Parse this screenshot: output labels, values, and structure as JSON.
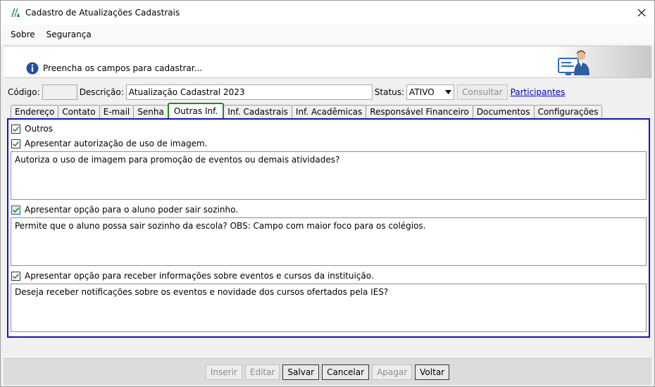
{
  "window": {
    "title": "Cadastro de Atualizações Cadastrais"
  },
  "menu": {
    "items": [
      "Sobre",
      "Segurança"
    ]
  },
  "hint": {
    "text": "Preencha os campos para cadastrar..."
  },
  "form": {
    "codigo_label": "Código:",
    "codigo_value": "",
    "descricao_label": "Descrição:",
    "descricao_value": "Atualização Cadastral 2023",
    "status_label": "Status:",
    "status_value": "ATIVO",
    "consultar_label": "Consultar",
    "participantes_label": "Participantes"
  },
  "tabs": [
    "Endereço",
    "Contato",
    "E-mail",
    "Senha",
    "Outras Inf.",
    "Inf. Cadastrais",
    "Inf. Acadêmicas",
    "Responsável Financeiro",
    "Documentos",
    "Configurações"
  ],
  "active_tab": "Outras Inf.",
  "options": {
    "outros": {
      "label": "Outros",
      "checked": true
    },
    "imagem": {
      "label": "Apresentar autorização de uso de imagem.",
      "checked": true,
      "text": "Autoriza o uso de imagem para promoção de eventos ou demais atividades?"
    },
    "sozinho": {
      "label": "Apresentar opção para o aluno poder sair sozinho.",
      "checked": true,
      "text": "Permite que o aluno possa sair sozinho da escola? OBS: Campo com maior foco para os colégios."
    },
    "eventos": {
      "label": "Apresentar opção para receber informações sobre eventos e cursos da instituição.",
      "checked": true,
      "text": "Deseja receber notificações sobre os eventos e novidade dos cursos ofertados pela IES?"
    }
  },
  "footer": {
    "inserir": "Inserir",
    "editar": "Editar",
    "salvar": "Salvar",
    "cancelar": "Cancelar",
    "apagar": "Apagar",
    "voltar": "Voltar"
  },
  "colors": {
    "active_tab_border": "#1e8b1e",
    "content_border": "#1010c8",
    "link": "#0000cc",
    "check": "#2e9a2e"
  },
  "icons": [
    "app-logo-icon",
    "close-icon",
    "info-icon",
    "user-computer-icon",
    "dropdown-arrow-icon",
    "checkmark-icon"
  ]
}
